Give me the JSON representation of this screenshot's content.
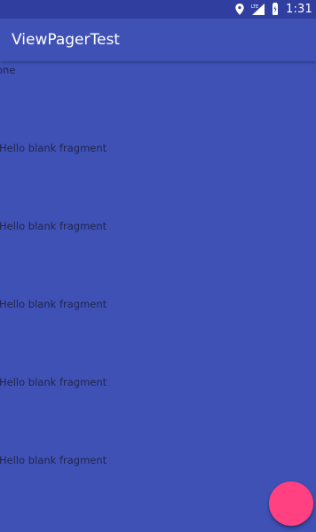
{
  "status_bar": {
    "time": "1:31",
    "network": "LTE",
    "icons": [
      "location-icon",
      "signal-lte-icon",
      "battery-icon"
    ]
  },
  "app_bar": {
    "title": "ViewPagerTest"
  },
  "content": {
    "tab_label": "one",
    "items": [
      "Hello blank fragment",
      "Hello blank fragment",
      "Hello blank fragment",
      "Hello blank fragment",
      "Hello blank fragment"
    ]
  },
  "colors": {
    "primary": "#3f51b5",
    "primary_dark": "#303f9f",
    "accent": "#ff4081",
    "text_dark": "#20264d"
  }
}
